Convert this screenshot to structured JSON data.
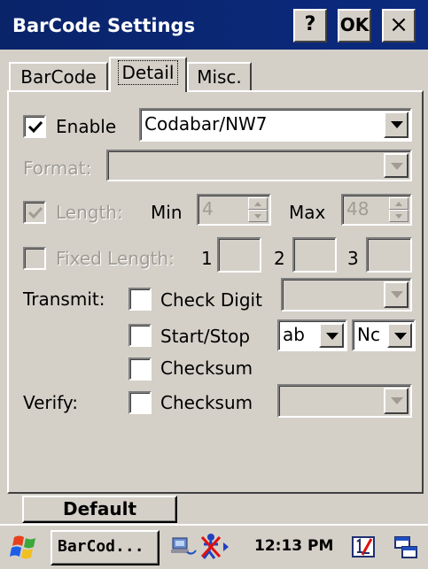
{
  "window": {
    "title": "BarCode Settings",
    "help_label": "?",
    "ok_label": "OK",
    "close_label": "×"
  },
  "tabs": [
    {
      "label": "BarCode",
      "active": false
    },
    {
      "label": "Detail",
      "active": true
    },
    {
      "label": "Misc.",
      "active": false
    }
  ],
  "detail": {
    "enable_label": "Enable",
    "enable_checked": true,
    "symbology_value": "Codabar/NW7",
    "format_label": "Format:",
    "format_value": "",
    "length_label": "Length:",
    "length_checked": true,
    "min_label": "Min",
    "min_value": "4",
    "max_label": "Max",
    "max_value": "48",
    "fixed_length_label": "Fixed Length:",
    "fixed_length_checked": false,
    "fixed_1_label": "1",
    "fixed_2_label": "2",
    "fixed_3_label": "3",
    "transmit_label": "Transmit:",
    "check_digit_label": "Check Digit",
    "start_stop_label": "Start/Stop",
    "start_stop_value_1": "ab",
    "start_stop_value_2": "Nc",
    "checksum_label": "Checksum",
    "verify_label": "Verify:",
    "verify_checksum_label": "Checksum",
    "default_button": "Default"
  },
  "taskbar": {
    "app_button": "BarCod...",
    "clock": "12:13 PM"
  }
}
